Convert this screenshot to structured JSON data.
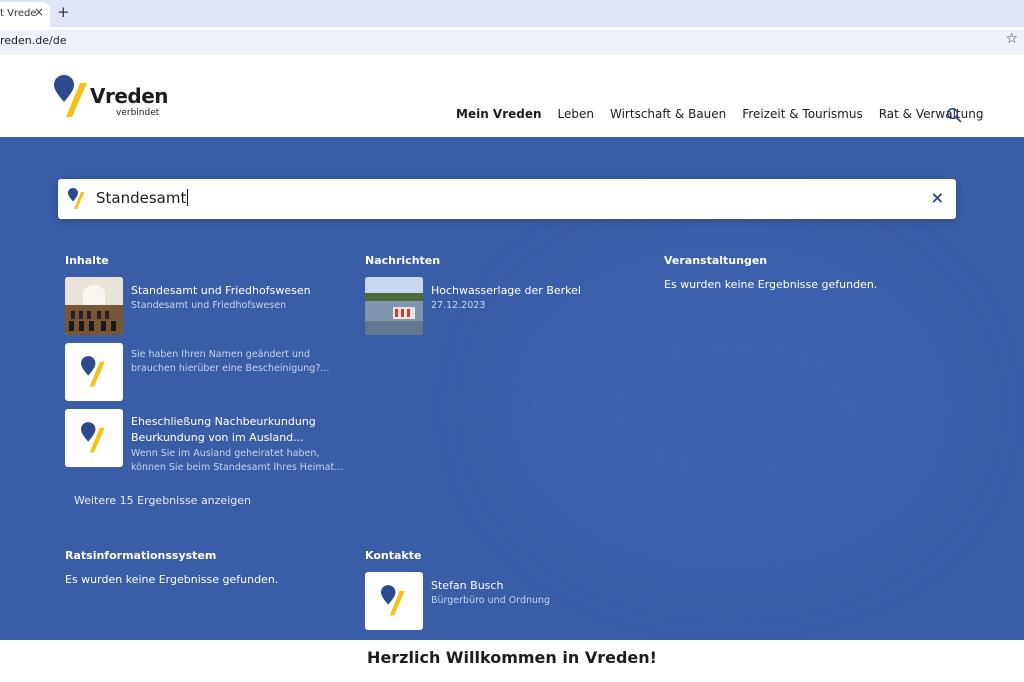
{
  "browser": {
    "tab_title": "t Vrede",
    "new_tab_symbol": "+",
    "close_symbol": "×",
    "url": "reden.de/de",
    "bookmark_symbol": "☆"
  },
  "header": {
    "logo_name": "Vreden",
    "logo_tagline": "verbindet",
    "nav": [
      {
        "label": "Mein Vreden",
        "active": true
      },
      {
        "label": "Leben",
        "active": false
      },
      {
        "label": "Wirtschaft & Bauen",
        "active": false
      },
      {
        "label": "Freizeit & Tourismus",
        "active": false
      },
      {
        "label": "Rat & Verwaltung",
        "active": false
      }
    ]
  },
  "colors": {
    "brand_blue": "#2c4a8d",
    "brand_yellow": "#f2c21b",
    "overlay_blue": "#3a5da8"
  },
  "search": {
    "value": "Standesamt",
    "clear_symbol": "×"
  },
  "columns": {
    "inhalte": {
      "title": "Inhalte",
      "results": [
        {
          "title": "Standesamt und Friedhofswesen",
          "title2": "",
          "subtitle": "Standesamt und Friedhofswesen",
          "subtitle2": "",
          "thumb": "photo-room"
        },
        {
          "title": "",
          "title2": "",
          "subtitle": "Sie haben Ihren Namen geändert und",
          "subtitle2": "brauchen hierüber eine Bescheinigung?...",
          "thumb": "logo"
        },
        {
          "title": "Eheschließung Nachbeurkundung",
          "title2": "Beurkundung von im Ausland...",
          "subtitle": "Wenn Sie im Ausland geheiratet haben,",
          "subtitle2": "können Sie beim Standesamt Ihres Heimat...",
          "thumb": "logo"
        }
      ],
      "more_label": "Weitere 15 Ergebnisse anzeigen"
    },
    "nachrichten": {
      "title": "Nachrichten",
      "results": [
        {
          "title": "Hochwasserlage der Berkel",
          "subtitle": "27.12.2023",
          "thumb": "photo-flood"
        }
      ]
    },
    "veranstaltungen": {
      "title": "Veranstaltungen",
      "empty": "Es wurden keine Ergebnisse gefunden."
    },
    "rats": {
      "title": "Ratsinformationssystem",
      "empty": "Es wurden keine Ergebnisse gefunden."
    },
    "kontakte": {
      "title": "Kontakte",
      "results": [
        {
          "title": "Stefan Busch",
          "subtitle": "Bürgerbüro und Ordnung",
          "thumb": "logo"
        }
      ]
    }
  },
  "welcome": {
    "text": "Herzlich Willkommen in Vreden!"
  }
}
